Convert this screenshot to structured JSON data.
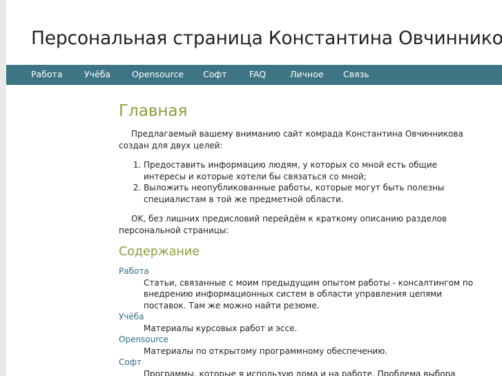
{
  "header": {
    "title": "Персональная страница Константина Овчинникова"
  },
  "nav": {
    "items": [
      {
        "label": "Работа"
      },
      {
        "label": "Учёба"
      },
      {
        "label": "Opensource"
      },
      {
        "label": "Софт"
      },
      {
        "label": "FAQ"
      },
      {
        "label": "Личное"
      },
      {
        "label": "Связь"
      }
    ]
  },
  "main": {
    "heading": "Главная",
    "intro": "Предлагаемый вашему вниманию сайт комрада Константина Овчинникова создан для двух целей:",
    "goals": [
      "Предоставить информацию людям, у которых со мной есть общие интересы и которые хотели бы связаться со мной;",
      "Выложить неопубликованные работы, которые могут быть полезны специалистам в той же предметной области."
    ],
    "transition": "OK, без лишних предисловий перейдём к краткому описанию разделов персональной страницы:",
    "contents_heading": "Содержание",
    "sections": [
      {
        "title": "Работа",
        "description": "Статьи, связанные с моим предыдущим опытом работы - консалтингом по внедрению информационных систем в области управления цепями поставок. Там же можно найти резюме."
      },
      {
        "title": "Учёба",
        "description": "Материалы курсовых работ и эссе."
      },
      {
        "title": "Opensource",
        "description": "Материалы по открытому программному обеспечению."
      },
      {
        "title": "Софт",
        "description": "Программы, которые я использую дома и на работе. Проблема выбора может занять"
      }
    ]
  }
}
